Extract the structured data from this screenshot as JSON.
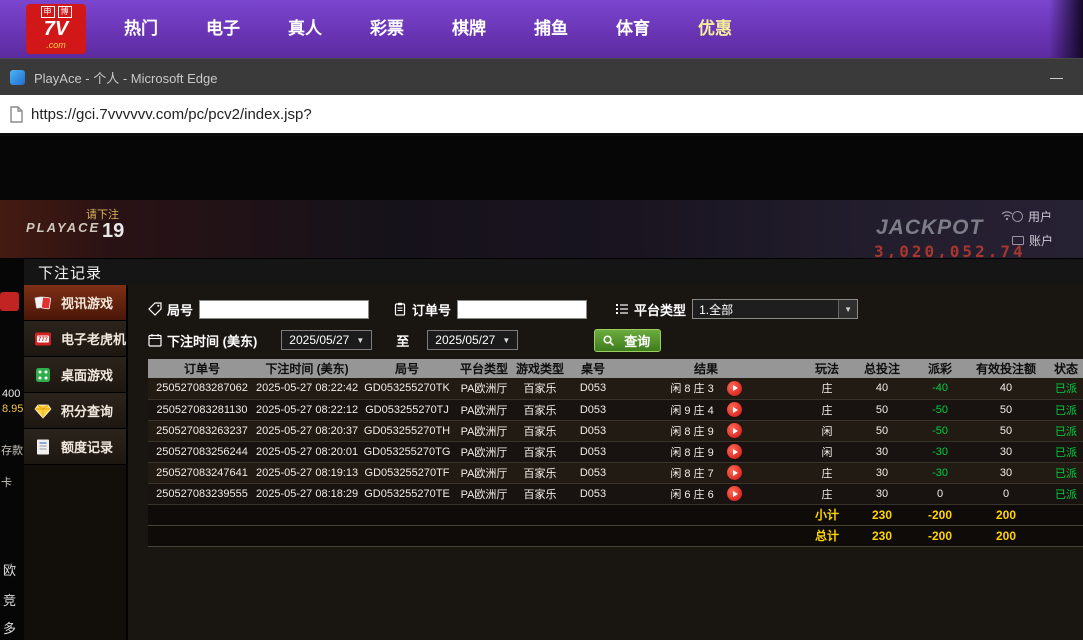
{
  "colors": {
    "accent_purple": "#6a35b5",
    "brand_red": "#d11717",
    "gold": "#ffd400",
    "win_green": "#00cf3f",
    "search_green": "#4e8f27"
  },
  "site_nav": {
    "logo": {
      "badge1": "申",
      "badge2": "博",
      "brand": "7V",
      "suffix": ".com"
    },
    "items": [
      {
        "label": "热门"
      },
      {
        "label": "电子"
      },
      {
        "label": "真人"
      },
      {
        "label": "彩票"
      },
      {
        "label": "棋牌"
      },
      {
        "label": "捕鱼"
      },
      {
        "label": "体育"
      },
      {
        "label": "优惠"
      }
    ]
  },
  "browser": {
    "window_title": "PlayAce - 个人 - Microsoft Edge",
    "minimize_glyph": "—",
    "url": "https://gci.7vvvvvv.com/pc/pcv2/index.jsp?"
  },
  "lobby_strip": {
    "brand": "PLAYACE",
    "bet_prompt": "请下注",
    "countdown": "19",
    "jackpot_label": "JACKPOT",
    "jackpot_value": "3,020,052.74",
    "user_label": "用户",
    "account_label": "账户"
  },
  "edge_widgets": {
    "balance_line1": "400",
    "balance_line2": "8.95",
    "frag_deposit": "存款",
    "frag_card": "卡",
    "frag_1": "欧",
    "frag_2": "竞",
    "frag_3": "多"
  },
  "records_panel": {
    "title": "下注记录",
    "sidebar": [
      {
        "label": "视讯游戏"
      },
      {
        "label": "电子老虎机"
      },
      {
        "label": "桌面游戏"
      },
      {
        "label": "积分查询"
      },
      {
        "label": "额度记录"
      }
    ],
    "filters": {
      "round_label": "局号",
      "order_label": "订单号",
      "platform_label": "平台类型",
      "platform_value": "1.全部",
      "time_label": "下注时间 (美东)",
      "date_from": "2025/05/27",
      "to_label": "至",
      "date_to": "2025/05/27",
      "caret_down": "▼",
      "search_label": "查询"
    },
    "table": {
      "headers": [
        "订单号",
        "下注时间 (美东)",
        "局号",
        "平台类型",
        "游戏类型",
        "桌号",
        "结果",
        "玩法",
        "总投注",
        "派彩",
        "有效投注额",
        "状态"
      ],
      "rows": [
        {
          "order": "250527083287062",
          "time": "2025-05-27 08:22:42",
          "round": "GD053255270TK",
          "platform": "PA欧洲厅",
          "game": "百家乐",
          "table_no": "D053",
          "result": "闲 8 庄 3",
          "play": "庄",
          "total": "40",
          "payout": "-40",
          "valid": "40",
          "status": "已派"
        },
        {
          "order": "250527083281130",
          "time": "2025-05-27 08:22:12",
          "round": "GD053255270TJ",
          "platform": "PA欧洲厅",
          "game": "百家乐",
          "table_no": "D053",
          "result": "闲 9 庄 4",
          "play": "庄",
          "total": "50",
          "payout": "-50",
          "valid": "50",
          "status": "已派"
        },
        {
          "order": "250527083263237",
          "time": "2025-05-27 08:20:37",
          "round": "GD053255270TH",
          "platform": "PA欧洲厅",
          "game": "百家乐",
          "table_no": "D053",
          "result": "闲 8 庄 9",
          "play": "闲",
          "total": "50",
          "payout": "-50",
          "valid": "50",
          "status": "已派"
        },
        {
          "order": "250527083256244",
          "time": "2025-05-27 08:20:01",
          "round": "GD053255270TG",
          "platform": "PA欧洲厅",
          "game": "百家乐",
          "table_no": "D053",
          "result": "闲 8 庄 9",
          "play": "闲",
          "total": "30",
          "payout": "-30",
          "valid": "30",
          "status": "已派"
        },
        {
          "order": "250527083247641",
          "time": "2025-05-27 08:19:13",
          "round": "GD053255270TF",
          "platform": "PA欧洲厅",
          "game": "百家乐",
          "table_no": "D053",
          "result": "闲 8 庄 7",
          "play": "庄",
          "total": "30",
          "payout": "-30",
          "valid": "30",
          "status": "已派"
        },
        {
          "order": "250527083239555",
          "time": "2025-05-27 08:18:29",
          "round": "GD053255270TE",
          "platform": "PA欧洲厅",
          "game": "百家乐",
          "table_no": "D053",
          "result": "闲 6 庄 6",
          "play": "庄",
          "total": "30",
          "payout": "0",
          "valid": "0",
          "status": "已派"
        }
      ],
      "subtotal": {
        "label": "小计",
        "total": "230",
        "payout": "-200",
        "valid": "200"
      },
      "grand_total": {
        "label": "总计",
        "total": "230",
        "payout": "-200",
        "valid": "200"
      }
    }
  }
}
